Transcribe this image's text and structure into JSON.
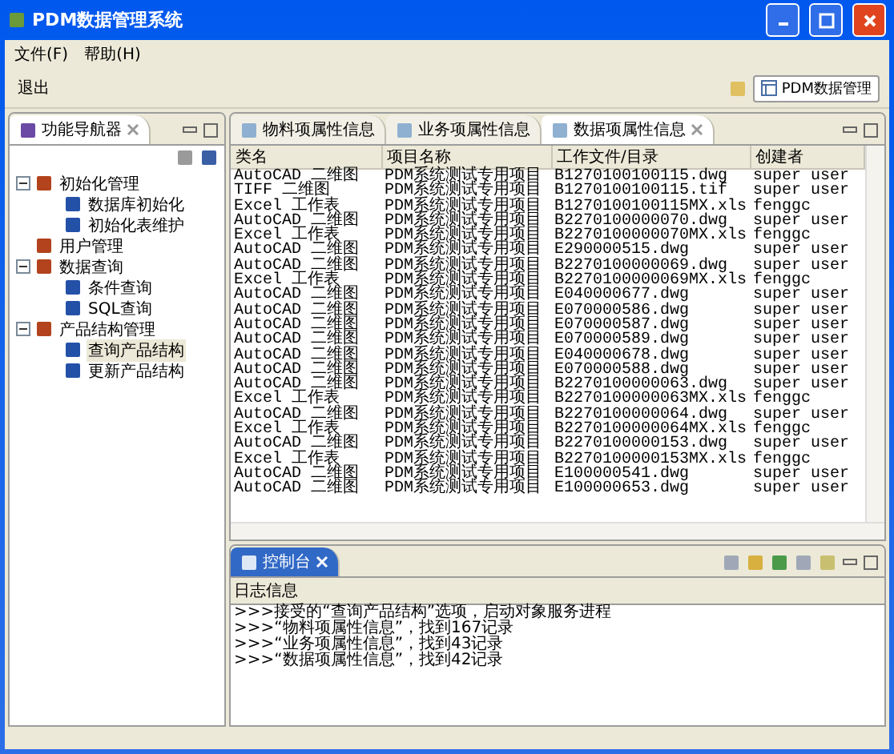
{
  "window": {
    "title": "PDM数据管理系统"
  },
  "menu": [
    "文件(F)",
    "帮助(H)"
  ],
  "toolbar": {
    "exit": "退出",
    "perspective": "PDM数据管理"
  },
  "navigator": {
    "title": "功能导航器",
    "tree": [
      {
        "label": "初始化管理",
        "expanded": true,
        "children": [
          {
            "label": "数据库初始化"
          },
          {
            "label": "初始化表维护"
          }
        ]
      },
      {
        "label": "用户管理"
      },
      {
        "label": "数据查询",
        "expanded": true,
        "children": [
          {
            "label": "条件查询"
          },
          {
            "label": "SQL查询"
          }
        ]
      },
      {
        "label": "产品结构管理",
        "expanded": true,
        "children": [
          {
            "label": "查询产品结构",
            "selected": true
          },
          {
            "label": "更新产品结构",
            "selected": false
          }
        ]
      }
    ]
  },
  "editor": {
    "tabs": [
      {
        "label": "物料项属性信息",
        "selected": false
      },
      {
        "label": "业务项属性信息",
        "selected": false
      },
      {
        "label": "数据项属性信息",
        "selected": true
      }
    ],
    "table": {
      "columns": [
        "类名",
        "项目名称",
        "工作文件/目录",
        "创建者"
      ],
      "rows": [
        [
          "AutoCAD 二维图",
          "PDM系统测试专用项目",
          "B1270100100115.dwg",
          "super user"
        ],
        [
          "TIFF 二维图",
          "PDM系统测试专用项目",
          "B1270100100115.tif",
          "super user"
        ],
        [
          "Excel 工作表",
          "PDM系统测试专用项目",
          "B1270100100115MX.xls",
          "fenggc"
        ],
        [
          "AutoCAD 二维图",
          "PDM系统测试专用项目",
          "B2270100000070.dwg",
          "super user"
        ],
        [
          "Excel 工作表",
          "PDM系统测试专用项目",
          "B2270100000070MX.xls",
          "fenggc"
        ],
        [
          "AutoCAD 二维图",
          "PDM系统测试专用项目",
          "E290000515.dwg",
          "super user"
        ],
        [
          "AutoCAD 二维图",
          "PDM系统测试专用项目",
          "B2270100000069.dwg",
          "super user"
        ],
        [
          "Excel 工作表",
          "PDM系统测试专用项目",
          "B2270100000069MX.xls",
          "fenggc"
        ],
        [
          "AutoCAD 二维图",
          "PDM系统测试专用项目",
          "E040000677.dwg",
          "super user"
        ],
        [
          "AutoCAD 二维图",
          "PDM系统测试专用项目",
          "E070000586.dwg",
          "super user"
        ],
        [
          "AutoCAD 二维图",
          "PDM系统测试专用项目",
          "E070000587.dwg",
          "super user"
        ],
        [
          "AutoCAD 二维图",
          "PDM系统测试专用项目",
          "E070000589.dwg",
          "super user"
        ],
        [
          "AutoCAD 二维图",
          "PDM系统测试专用项目",
          "E040000678.dwg",
          "super user"
        ],
        [
          "AutoCAD 二维图",
          "PDM系统测试专用项目",
          "E070000588.dwg",
          "super user"
        ],
        [
          "AutoCAD 二维图",
          "PDM系统测试专用项目",
          "B2270100000063.dwg",
          "super user"
        ],
        [
          "Excel 工作表",
          "PDM系统测试专用项目",
          "B2270100000063MX.xls",
          "fenggc"
        ],
        [
          "AutoCAD 二维图",
          "PDM系统测试专用项目",
          "B2270100000064.dwg",
          "super user"
        ],
        [
          "Excel 工作表",
          "PDM系统测试专用项目",
          "B2270100000064MX.xls",
          "fenggc"
        ],
        [
          "AutoCAD 二维图",
          "PDM系统测试专用项目",
          "B2270100000153.dwg",
          "super user"
        ],
        [
          "Excel 工作表",
          "PDM系统测试专用项目",
          "B2270100000153MX.xls",
          "fenggc"
        ],
        [
          "AutoCAD 二维图",
          "PDM系统测试专用项目",
          "E100000541.dwg",
          "super user"
        ],
        [
          "AutoCAD 二维图",
          "PDM系统测试专用项目",
          "E100000653.dwg",
          "super user"
        ]
      ]
    }
  },
  "console": {
    "tab": {
      "label": "控制台",
      "selected": true
    },
    "header": "日志信息",
    "lines": [
      ">>>接受的“查询产品结构”选项，启动对象服务进程",
      ">>>“物料项属性信息”，找到167记录",
      ">>>“业务项属性信息”，找到43记录",
      ">>>“数据项属性信息”，找到42记录"
    ]
  }
}
